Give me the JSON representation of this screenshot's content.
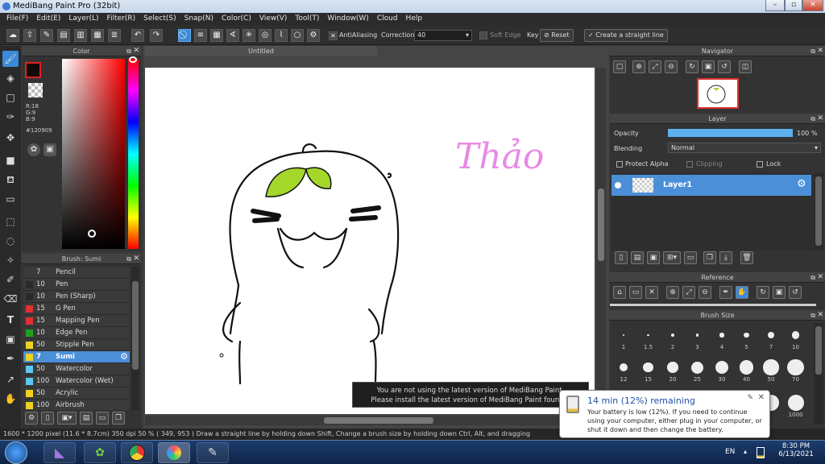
{
  "window": {
    "title": "MediBang Paint Pro (32bit)",
    "minimize": "–",
    "maximize": "▫",
    "close": "✕"
  },
  "menu": [
    "File(F)",
    "Edit(E)",
    "Layer(L)",
    "Filter(R)",
    "Select(S)",
    "Snap(N)",
    "Color(C)",
    "View(V)",
    "Tool(T)",
    "Window(W)",
    "Cloud",
    "Help"
  ],
  "toolbar": {
    "antialiasing_label": "AntiAliasing",
    "correction_label": "Correction",
    "correction_value": "40",
    "soft_edge_label": "Soft Edge",
    "key_label": "Key",
    "reset_label": "Reset",
    "straight_line_label": "Create a straight line"
  },
  "color_panel": {
    "title": "Color",
    "rgb": {
      "r": "R:18",
      "g": "G:9",
      "b": "B:9"
    },
    "hex": "#120909",
    "fg_color": "#120909"
  },
  "brush_panel": {
    "title": "Brush: Sumi",
    "items": [
      {
        "size": "7",
        "name": "Pencil",
        "color": "#3a3a3a",
        "selected": false
      },
      {
        "size": "10",
        "name": "Pen",
        "color": "#2a2a2a",
        "selected": false
      },
      {
        "size": "10",
        "name": "Pen (Sharp)",
        "color": "#2a2a2a",
        "selected": false
      },
      {
        "size": "15",
        "name": "G Pen",
        "color": "#e03030",
        "selected": false
      },
      {
        "size": "15",
        "name": "Mapping Pen",
        "color": "#e03030",
        "selected": false
      },
      {
        "size": "10",
        "name": "Edge Pen",
        "color": "#1fa01f",
        "selected": false
      },
      {
        "size": "50",
        "name": "Stipple Pen",
        "color": "#f0d020",
        "selected": false
      },
      {
        "size": "7",
        "name": "Sumi",
        "color": "#f0d020",
        "selected": true
      },
      {
        "size": "50",
        "name": "Watercolor",
        "color": "#5bc8f0",
        "selected": false
      },
      {
        "size": "100",
        "name": "Watercolor (Wet)",
        "color": "#5bc8f0",
        "selected": false
      },
      {
        "size": "50",
        "name": "Acrylic",
        "color": "#f0d020",
        "selected": false
      },
      {
        "size": "100",
        "name": "Airbrush",
        "color": "#f0d020",
        "selected": false
      }
    ]
  },
  "document": {
    "tab_title": "Untitled",
    "drawing_text": "Thảo"
  },
  "notice": {
    "line1": "You are not using the latest version of MediBang Paint.",
    "line2": "Please install the latest version of MediBang Paint found h"
  },
  "navigator": {
    "title": "Navigator"
  },
  "layer_panel": {
    "title": "Layer",
    "opacity_label": "Opacity",
    "opacity_value": "100 %",
    "opacity_fraction": 1.0,
    "blending_label": "Blending",
    "blending_value": "Normal",
    "protect_alpha_label": "Protect Alpha",
    "clipping_label": "Clipping",
    "lock_label": "Lock",
    "layers": [
      {
        "name": "Layer1",
        "selected": true
      }
    ]
  },
  "reference_panel": {
    "title": "Reference"
  },
  "brush_size_panel": {
    "title": "Brush Size",
    "row1": [
      "1",
      "1.5",
      "2",
      "3",
      "4",
      "5",
      "7",
      "10"
    ],
    "row2": [
      "12",
      "15",
      "20",
      "25",
      "30",
      "40",
      "50",
      "70"
    ],
    "row3_last": "1000"
  },
  "status": {
    "size": "1600 * 1200 pixel",
    "physical": "(11.6 * 8.7cm)",
    "dpi": "350 dpi",
    "zoom": "50 %",
    "coords": "( 349, 953 )",
    "hint": "Draw a straight line by holding down Shift, Change a brush size by holding down Ctrl, Alt, and dragging"
  },
  "battery_balloon": {
    "title": "14 min (12%) remaining",
    "body": "Your battery is low (12%). If you need to continue using your computer, either plug in your computer, or shut it down and then change the battery."
  },
  "taskbar": {
    "language": "EN",
    "time": "8:30 PM",
    "date": "6/13/2021"
  }
}
